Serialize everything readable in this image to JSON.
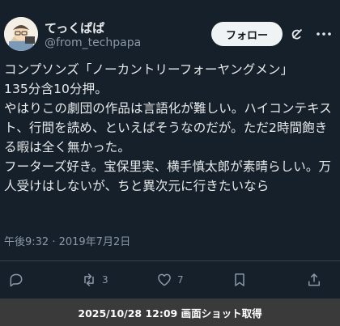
{
  "user": {
    "display_name": "てっくぱぱ",
    "handle": "@from_techpapa"
  },
  "follow_label": "フォロー",
  "tweet": {
    "text": "コンプソンズ「ノーカントリーフォーヤングメン」\n135分含10分押。\nやはりこの劇団の作品は言語化が難しい。ハイコンテキスト、行間を読め、といえばそうなのだが。ただ2時間飽きる暇は全く無かった。\nフーターズ好き。宝保里実、横手慎太郎が素晴らしい。万人受けはしないが、ちと異次元に行きたいなら",
    "timestamp": "午後9:32 · 2019年7月2日"
  },
  "actions": {
    "retweets": "3",
    "likes": "7"
  },
  "caption": "2025/10/28 12:09 画面ショット取得",
  "colors": {
    "background": "#15202b",
    "text": "#e7e9ea",
    "secondary": "#8b98a5",
    "caption_bg": "#3a3a3a"
  },
  "icons": [
    "avatar",
    "grok-icon",
    "more-icon",
    "reply-icon",
    "retweet-icon",
    "like-icon",
    "bookmark-icon",
    "share-icon"
  ]
}
